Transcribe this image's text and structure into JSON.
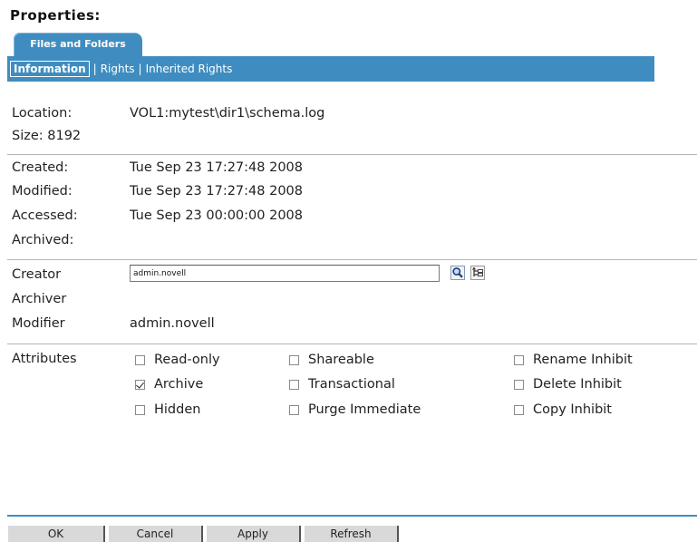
{
  "page_title": "Properties:",
  "tab": {
    "label": "Files and Folders"
  },
  "subnav": {
    "information": "Information",
    "sep1": "|",
    "rights": "Rights",
    "sep2": "|",
    "inherited_rights": "Inherited Rights"
  },
  "info": {
    "location_label": "Location:",
    "location_value": "VOL1:mytest\\dir1\\schema.log",
    "size_label": "Size: 8192"
  },
  "dates": {
    "created_label": "Created:",
    "created_value": "Tue Sep 23 17:27:48 2008",
    "modified_label": "Modified:",
    "modified_value": "Tue Sep 23 17:27:48 2008",
    "accessed_label": "Accessed:",
    "accessed_value": "Tue Sep 23 00:00:00 2008",
    "archived_label": "Archived:"
  },
  "owners": {
    "creator_label": "Creator",
    "creator_value": "admin.novell",
    "archiver_label": "Archiver",
    "modifier_label": "Modifier",
    "modifier_value": "admin.novell"
  },
  "attributes": {
    "label": "Attributes",
    "read_only": {
      "label": "Read-only",
      "checked": false
    },
    "archive": {
      "label": "Archive",
      "checked": true
    },
    "hidden": {
      "label": "Hidden",
      "checked": false
    },
    "shareable": {
      "label": "Shareable",
      "checked": false
    },
    "transactional": {
      "label": "Transactional",
      "checked": false
    },
    "purge_immediate": {
      "label": "Purge Immediate",
      "checked": false
    },
    "rename_inhibit": {
      "label": "Rename Inhibit",
      "checked": false
    },
    "delete_inhibit": {
      "label": "Delete Inhibit",
      "checked": false
    },
    "copy_inhibit": {
      "label": "Copy Inhibit",
      "checked": false
    }
  },
  "buttons": {
    "ok": "OK",
    "cancel": "Cancel",
    "apply": "Apply",
    "refresh": "Refresh"
  },
  "colors": {
    "accent": "#3f8dc0"
  }
}
